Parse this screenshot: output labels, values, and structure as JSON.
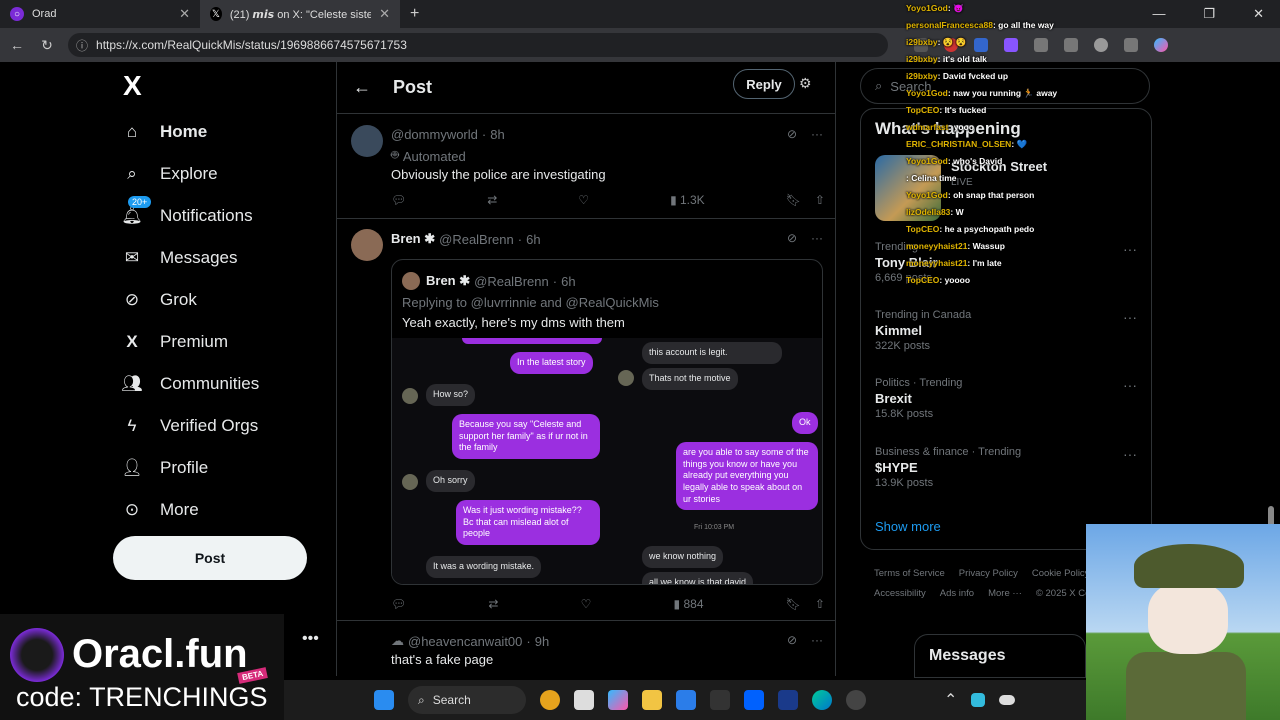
{
  "browser": {
    "tabs": [
      {
        "title": "Orad"
      },
      {
        "title": "(21) 𝙢𝙞𝙨 on X: \"Celeste sister spe"
      }
    ],
    "new_tab": "+",
    "url": "https://x.com/RealQuickMis/status/1969886674575671753"
  },
  "nav": {
    "logo": "X",
    "items": [
      {
        "label": "Home",
        "icon": "home-icon"
      },
      {
        "label": "Explore",
        "icon": "search-icon"
      },
      {
        "label": "Notifications",
        "icon": "bell-icon",
        "badge": "20+"
      },
      {
        "label": "Messages",
        "icon": "mail-icon"
      },
      {
        "label": "Grok",
        "icon": "grok-icon"
      },
      {
        "label": "Premium",
        "icon": "x-icon"
      },
      {
        "label": "Communities",
        "icon": "people-icon"
      },
      {
        "label": "Verified Orgs",
        "icon": "bolt-icon"
      },
      {
        "label": "Profile",
        "icon": "person-icon"
      },
      {
        "label": "More",
        "icon": "more-circle-icon"
      }
    ],
    "post_button": "Post",
    "more_dots": "•••"
  },
  "main": {
    "title": "Post",
    "reply_button": "Reply",
    "tweets": [
      {
        "handle": "@dommyworld",
        "time": "8h",
        "label": "Automated",
        "text": "Obviously the police are investigating",
        "views": "1.3K"
      },
      {
        "name": "Bren ✱",
        "handle": "@RealBrenn",
        "time": "6h",
        "quote": {
          "name": "Bren ✱",
          "handle": "@RealBrenn",
          "time": "6h",
          "replying": "Replying to @luvrrinnie and @RealQuickMis",
          "text": "Yeah exactly,  here's my dms with them"
        },
        "views": "884"
      },
      {
        "handle": "@heavencanwait00",
        "time": "9h",
        "text": "that's a fake page"
      }
    ],
    "dm": {
      "left_bubbles": [
        "In the latest story",
        "How so?",
        "Because you say \"Celeste and support her family\" as if ur not in the family",
        "Oh sorry",
        "Was it just wording mistake?? Bc that can mislead alot of people",
        "It was a wording mistake."
      ],
      "right_bubbles": [
        "this account is legit.",
        "Thats not the motive",
        "Ok",
        "are you able to say some of the things you know or have you already put everything you legally able to speak about on ur stories",
        "we know nothing",
        "all we know is that david"
      ],
      "timestamp": "Fri 10:03 PM"
    }
  },
  "right": {
    "search_placeholder": "Search",
    "card_title": "What's happening",
    "event": {
      "title": "Stockton Street",
      "status": "LIVE"
    },
    "trends": [
      {
        "context": "Trending",
        "name": "Tony Blair",
        "count": "6,669 posts"
      },
      {
        "context": "Trending in Canada",
        "name": "Kimmel",
        "count": "322K posts"
      },
      {
        "context": "Politics · Trending",
        "name": "Brexit",
        "count": "15.8K posts"
      },
      {
        "context": "Business & finance · Trending",
        "name": "$HYPE",
        "count": "13.9K posts"
      }
    ],
    "show_more": "Show more",
    "footer": [
      "Terms of Service",
      "Privacy Policy",
      "Cookie Policy",
      "Accessibility",
      "Ads info",
      "More ···",
      "© 2025 X Corp."
    ],
    "messages_dock": "Messages"
  },
  "chat": [
    {
      "user": "Yoyo1God",
      "msg": ": 😈"
    },
    {
      "user": "personalFrancesca88",
      "msg": ": go all the way"
    },
    {
      "user": "i29bxby",
      "msg": ": 😵 😵"
    },
    {
      "user": "i29bxby",
      "msg": ": it's old talk"
    },
    {
      "user": "i29bxby",
      "msg": ": David fvcked up"
    },
    {
      "user": "Yoyo1God",
      "msg": ": naw you running 🏃 away"
    },
    {
      "user": "TopCEO",
      "msg": ": It's fucked"
    },
    {
      "user": "wdmarfast",
      "msg": ": yooo"
    },
    {
      "user": "ERIC_CHRISTIAN_OLSEN",
      "msg": ": 💙"
    },
    {
      "user": "Yoyo1God",
      "msg": ": who's David"
    },
    {
      "user": "",
      "msg": ": Celina time"
    },
    {
      "user": "Yoyo1God",
      "msg": ": oh snap that person"
    },
    {
      "user": "lizOdella83",
      "msg": ": W"
    },
    {
      "user": "TopCEO",
      "msg": ": he a psychopath pedo"
    },
    {
      "user": "moneyyhaist21",
      "msg": ": Wassup"
    },
    {
      "user": "moneyyhaist21",
      "msg": ": I'm late"
    },
    {
      "user": "TopCEO",
      "msg": ": yoooo"
    }
  ],
  "promo": {
    "brand": "Oracl.fun",
    "beta": "BETA",
    "code": "code: TRENCHINGS"
  },
  "taskbar": {
    "search": "Search"
  }
}
